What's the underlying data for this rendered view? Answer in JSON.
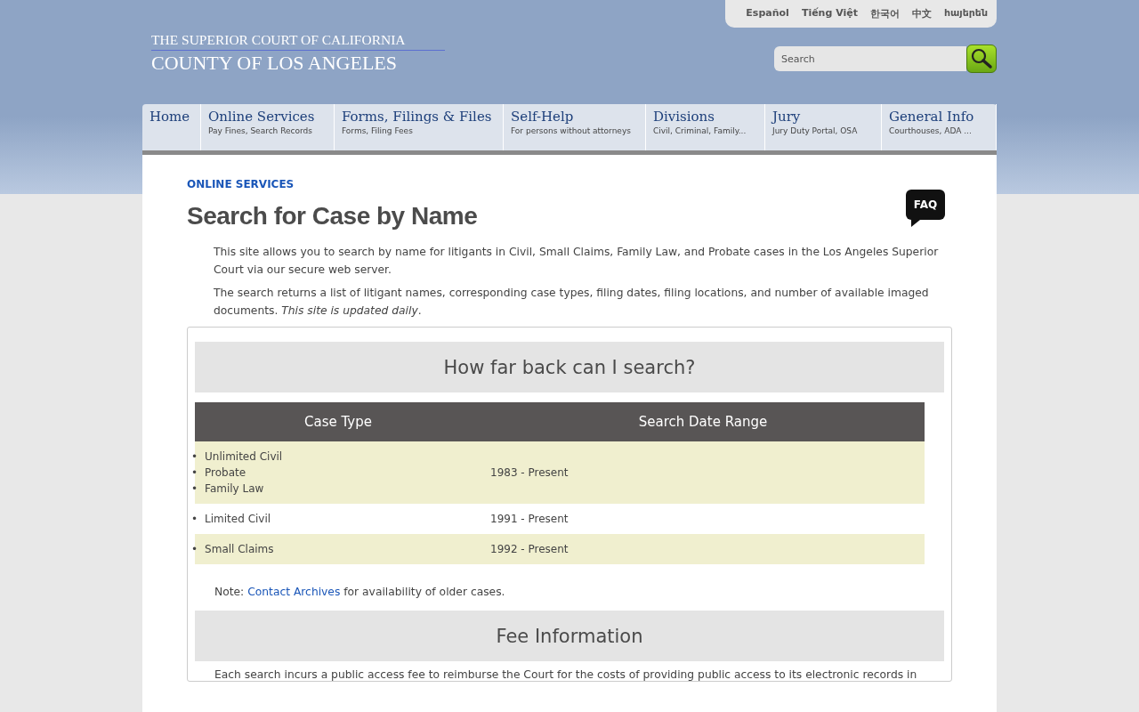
{
  "languages": [
    "Español",
    "Tiếng Việt",
    "한국어",
    "中文",
    "հայերեն"
  ],
  "logo": {
    "line1": "THE SUPERIOR COURT OF CALIFORNIA",
    "line2": "COUNTY OF LOS ANGELES"
  },
  "search": {
    "placeholder": "Search"
  },
  "nav": [
    {
      "label": "Home"
    },
    {
      "label": "Online Services",
      "sub": "Pay Fines, Search Records"
    },
    {
      "label": "Forms, Filings & Files",
      "sub": "Forms, Filing Fees"
    },
    {
      "label": "Self-Help",
      "sub": "For persons without attorneys"
    },
    {
      "label": "Divisions",
      "sub": "Civil, Criminal, Family..."
    },
    {
      "label": "Jury",
      "sub": "Jury Duty Portal, OSA"
    },
    {
      "label": "General Info",
      "sub": "Courthouses, ADA ..."
    }
  ],
  "breadcrumb": "ONLINE SERVICES",
  "title": "Search for Case by Name",
  "faq": "FAQ",
  "intro": [
    "This site allows you to search by name for litigants in Civil, Small Claims, Family Law, and Probate cases in the Los Angeles Superior Court via our secure web server.",
    "The search returns a list of litigant names, corresponding case types, filing dates, filing locations, and number of available imaged documents. *This site is updated daily*."
  ],
  "section1": {
    "heading": "How far back can I search?",
    "table": {
      "bullet": "•",
      "columns": [
        "Case Type",
        "Search Date Range"
      ],
      "rows": [
        {
          "case_types": [
            "Unlimited Civil",
            "Probate",
            "Family Law"
          ],
          "range": "1983 - Present"
        },
        {
          "case_types": [
            "Limited Civil"
          ],
          "range": "1991 - Present"
        },
        {
          "case_types": [
            "Small Claims"
          ],
          "range": "1992 - Present"
        }
      ]
    },
    "note": {
      "before": "Note: ",
      "link": "Contact Archives",
      "after": " for availability of older cases."
    }
  },
  "section2": {
    "heading": "Fee Information",
    "text": "Each search incurs a public access fee to reimburse the Court for the costs of providing public access to its electronic records in"
  }
}
